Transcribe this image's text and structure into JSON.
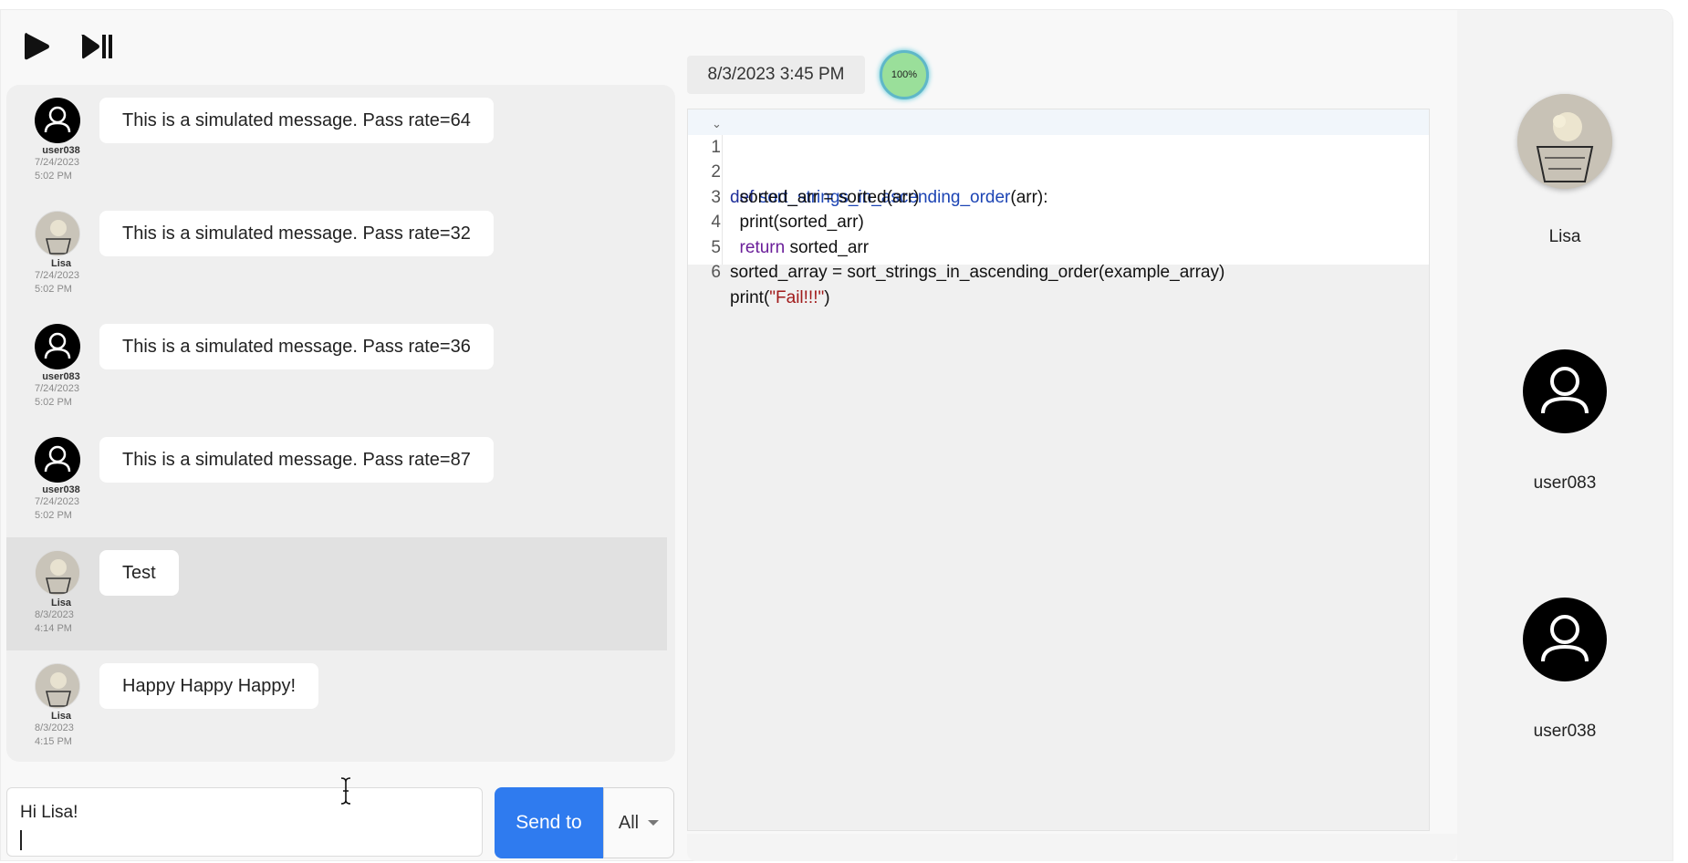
{
  "toolbar": {
    "play_icon": "play-icon",
    "step_icon": "play-pause-icon"
  },
  "chat": {
    "messages": [
      {
        "user": "user038",
        "date": "7/24/2023",
        "time": "5:02 PM",
        "text": "This is a simulated message. Pass rate=64",
        "avatar": "user-icon"
      },
      {
        "user": "Lisa",
        "date": "7/24/2023",
        "time": "5:02 PM",
        "text": "This is a simulated message. Pass rate=32",
        "avatar": "photo"
      },
      {
        "user": "user083",
        "date": "7/24/2023",
        "time": "5:02 PM",
        "text": "This is a simulated message. Pass rate=36",
        "avatar": "user-icon"
      },
      {
        "user": "user038",
        "date": "7/24/2023",
        "time": "5:02 PM",
        "text": "This is a simulated message. Pass rate=87",
        "avatar": "user-icon"
      },
      {
        "user": "Lisa",
        "date": "8/3/2023",
        "time": "4:14 PM",
        "text": "Test",
        "avatar": "photo"
      },
      {
        "user": "Lisa",
        "date": "8/3/2023",
        "time": "4:15 PM",
        "text": "Happy Happy Happy!",
        "avatar": "photo"
      }
    ]
  },
  "composer": {
    "value": "Hi Lisa!",
    "send_label": "Send to",
    "scope_value": "All"
  },
  "editor": {
    "timestamp": "8/3/2023 3:45 PM",
    "progress": "100%",
    "line_numbers": [
      "1",
      "2",
      "3",
      "4",
      "5",
      "6"
    ],
    "lines": [
      {
        "kw": "def ",
        "fn": "sort_strings_in_ascending_order",
        "rest": "(arr):"
      },
      {
        "text": "  sorted_arr = sorted(arr)"
      },
      {
        "text": "  print(sorted_arr)"
      },
      {
        "kw": "  return",
        "rest": " sorted_arr"
      },
      {
        "text": "sorted_array = sort_strings_in_ascending_order(example_array)"
      },
      {
        "pre": "print(",
        "str": "\"Fail!!!\"",
        "post": ")"
      }
    ]
  },
  "participants": [
    {
      "name": "Lisa",
      "avatar": "photo"
    },
    {
      "name": "user083",
      "avatar": "user-icon"
    },
    {
      "name": "user038",
      "avatar": "user-icon"
    }
  ]
}
